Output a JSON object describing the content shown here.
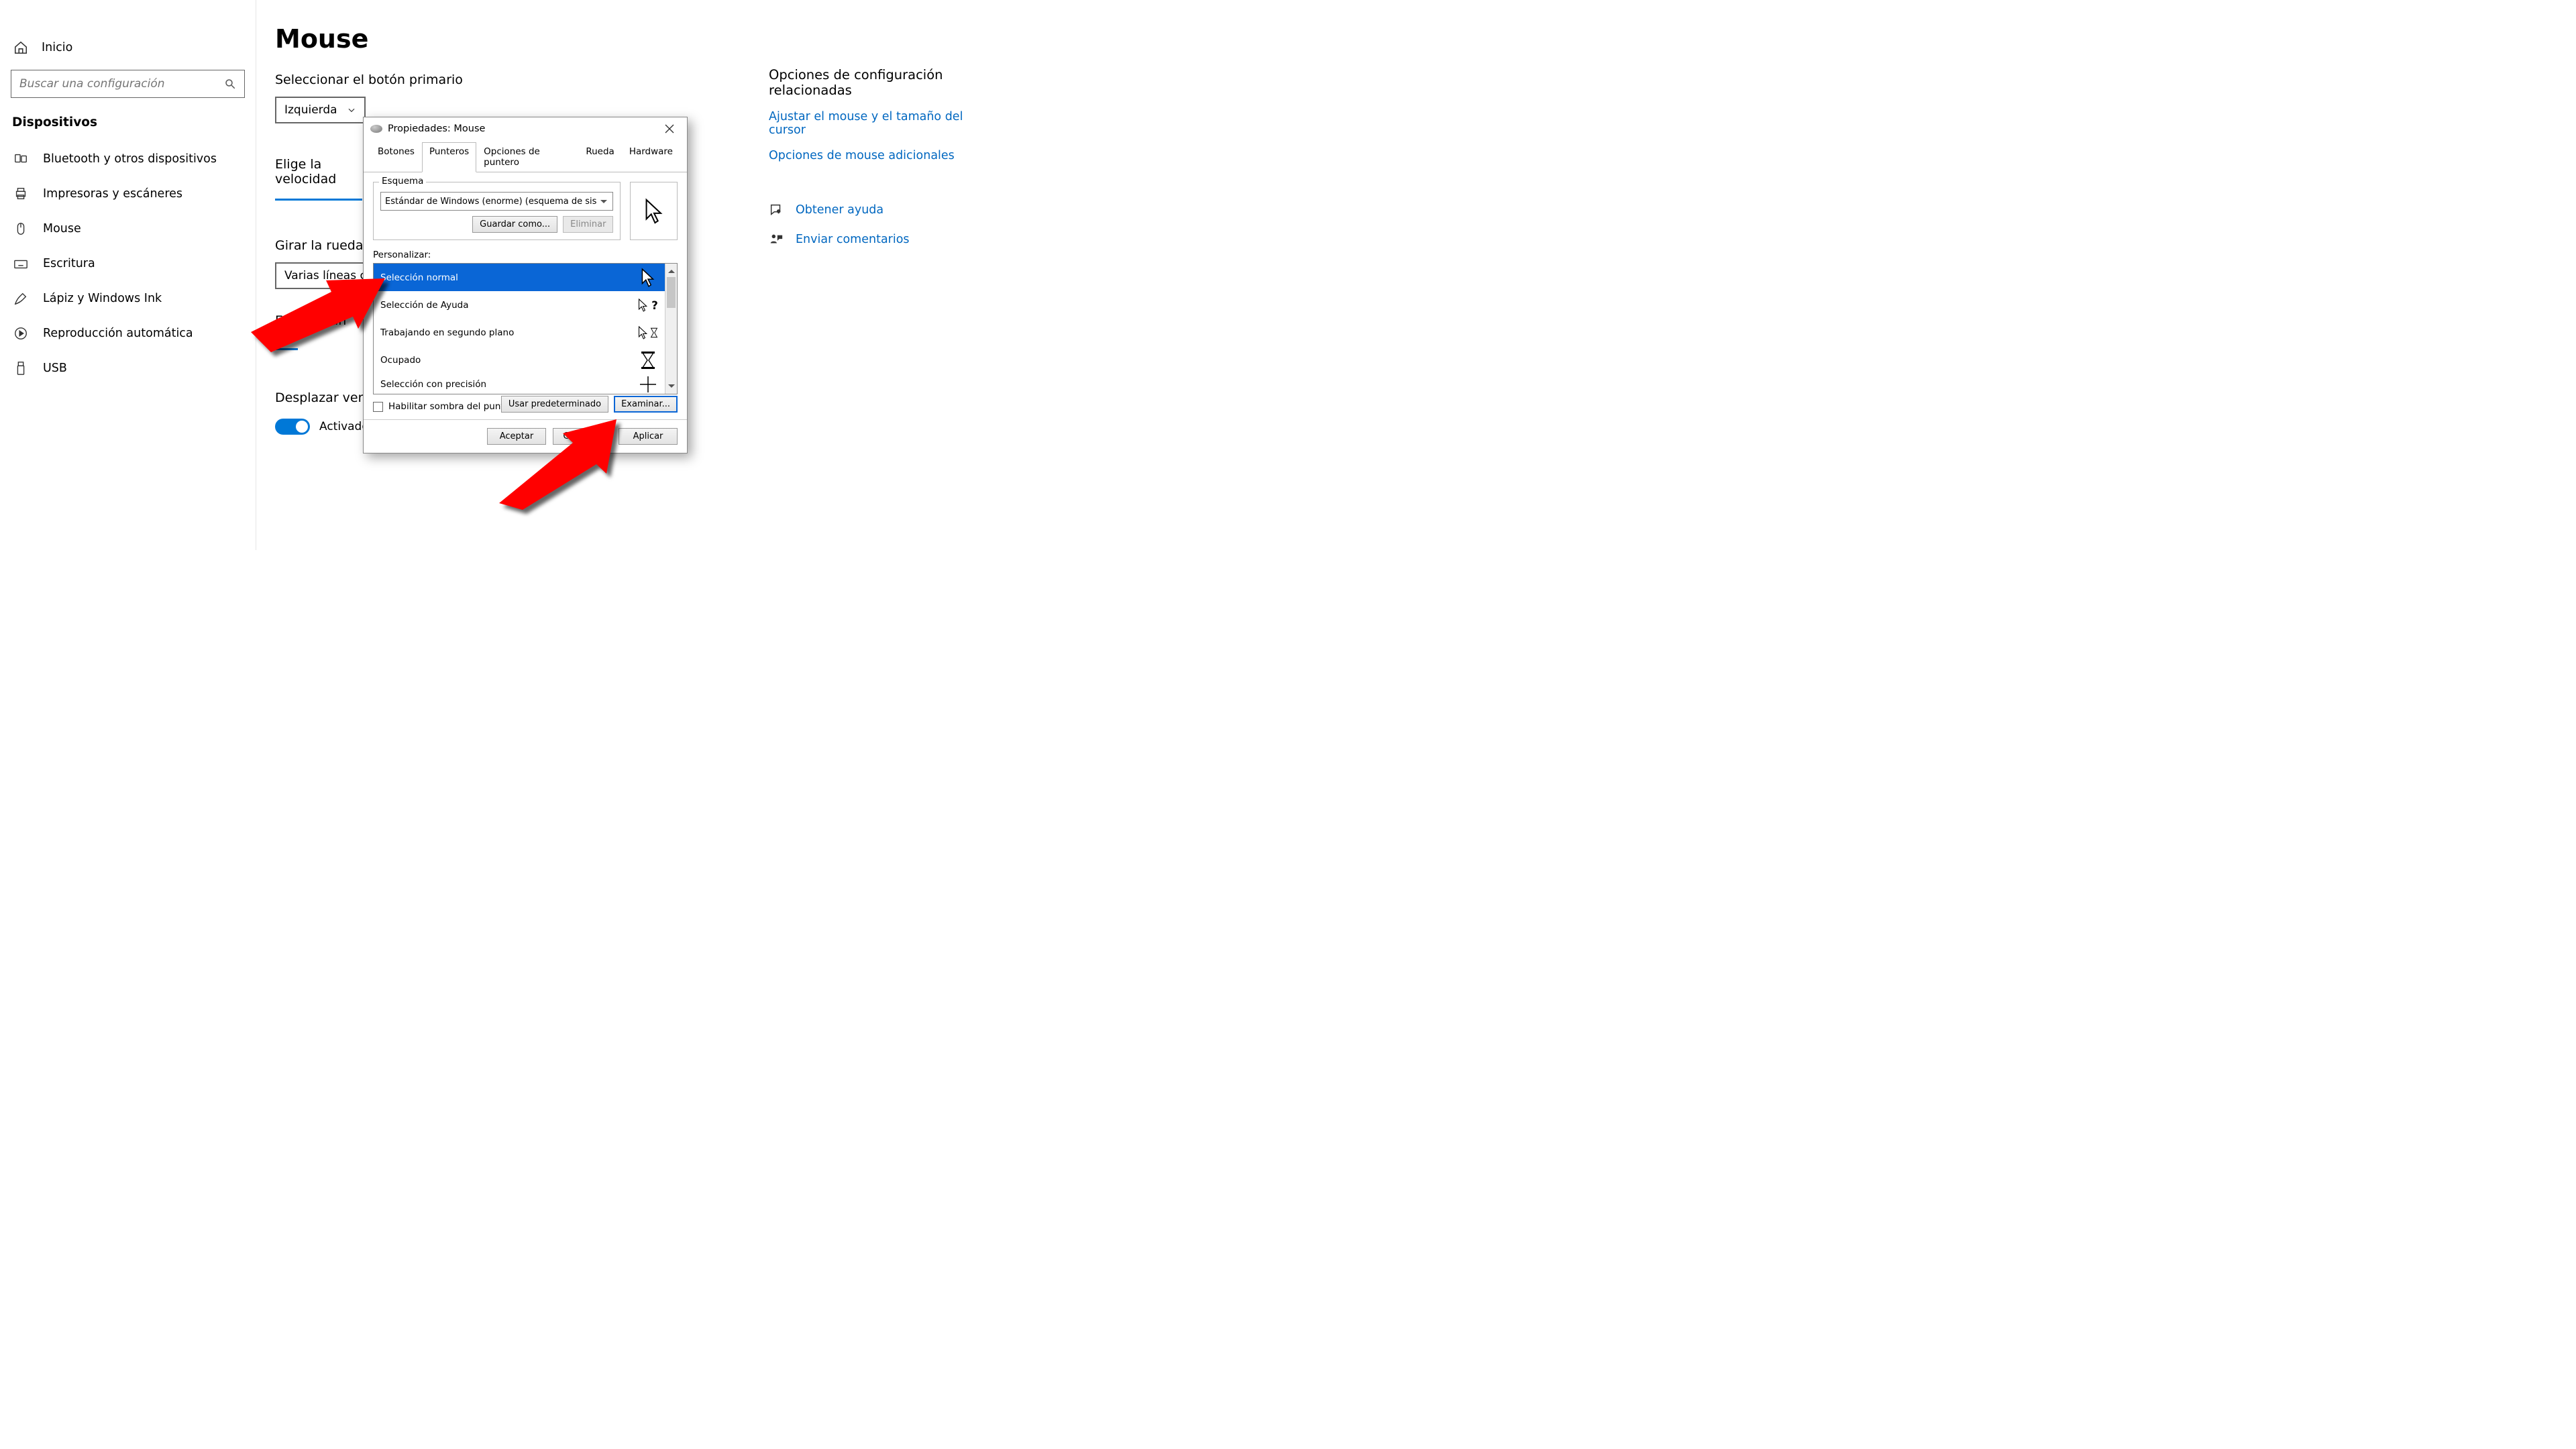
{
  "sidebar": {
    "home": "Inicio",
    "search_placeholder": "Buscar una configuración",
    "section": "Dispositivos",
    "items": [
      "Bluetooth y otros dispositivos",
      "Impresoras y escáneres",
      "Mouse",
      "Escritura",
      "Lápiz y Windows Ink",
      "Reproducción automática",
      "USB"
    ]
  },
  "main": {
    "title": "Mouse",
    "primary_label": "Seleccionar el botón primario",
    "primary_value": "Izquierda",
    "speed_label": "Elige la velocidad",
    "wheel_label": "Girar la rueda del",
    "wheel_value": "Varias líneas ca",
    "lines_label": "Elegir cuán",
    "scroll_label": "Desplazar ventan",
    "toggle_value": "Activado"
  },
  "rail": {
    "title": "Opciones de configuración relacionadas",
    "link1": "Ajustar el mouse y el tamaño del cursor",
    "link2": "Opciones de mouse adicionales",
    "help": "Obtener ayuda",
    "feedback": "Enviar comentarios"
  },
  "dialog": {
    "title": "Propiedades: Mouse",
    "tabs": [
      "Botones",
      "Punteros",
      "Opciones de puntero",
      "Rueda",
      "Hardware"
    ],
    "active_tab": 1,
    "scheme_label": "Esquema",
    "scheme_value": "Estándar de Windows (enorme) (esquema de sis",
    "save_as": "Guardar como...",
    "delete": "Eliminar",
    "customize_label": "Personalizar:",
    "items": [
      "Selección normal",
      "Selección de Ayuda",
      "Trabajando en segundo plano",
      "Ocupado",
      "Selección con precisión"
    ],
    "shadow": "Habilitar sombra del puntero",
    "use_default": "Usar predeterminado",
    "browse": "Examinar...",
    "ok": "Aceptar",
    "cancel": "Cancelar",
    "apply": "Aplicar"
  }
}
